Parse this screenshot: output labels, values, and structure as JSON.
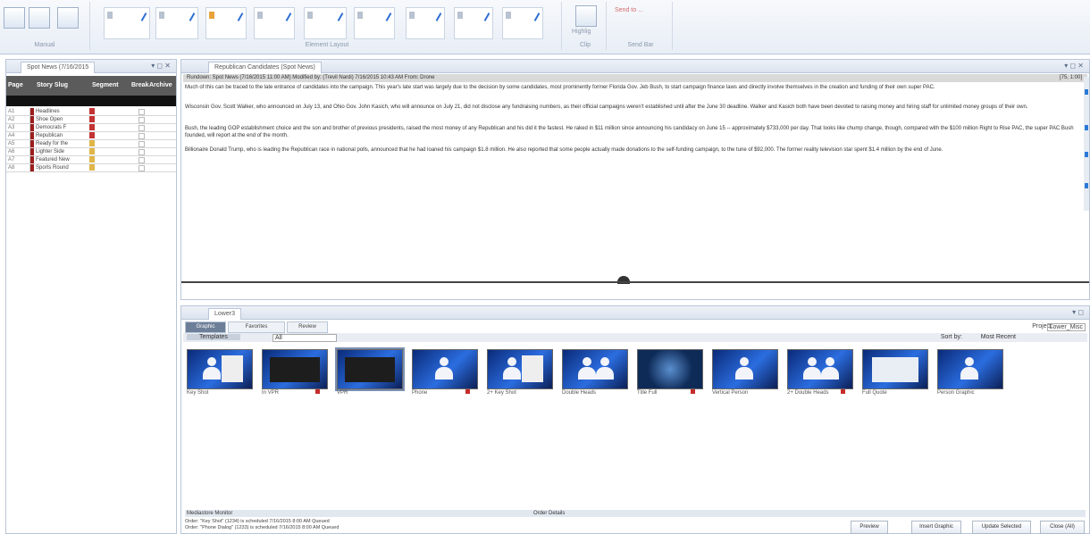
{
  "ribbon": {
    "groups": [
      {
        "label": "Manual"
      },
      {
        "label": "Element Layout"
      },
      {
        "label": "Clip"
      },
      {
        "label": "Send Bar"
      }
    ],
    "highlight_label": "Highlig",
    "send_label": "Send to ..."
  },
  "rundown_pane": {
    "tab": "Spot News (7/16/2015",
    "columns": [
      "Page",
      "Story Slug",
      "Segment",
      "Break",
      "Archive"
    ],
    "rows": [
      {
        "page": "A1",
        "slug": "Headlines"
      },
      {
        "page": "A2",
        "slug": "Shoe Open"
      },
      {
        "page": "A3",
        "slug": "Democrats F"
      },
      {
        "page": "A4",
        "slug": "Republican"
      },
      {
        "page": "A5",
        "slug": "Ready for the"
      },
      {
        "page": "A6",
        "slug": "Lighter Side"
      },
      {
        "page": "A7",
        "slug": "Featured New"
      },
      {
        "page": "A8",
        "slug": "Sports Round"
      }
    ]
  },
  "story_pane": {
    "tab": "Republican Candidates (Spot News)",
    "status": "Rundown: Spot News (7/16/2015 11:00 AM)    Modified by: (Trevil Nardi)    7/16/2015 10:43 AM    From: Drone",
    "count": "[75, 1:00]",
    "paragraphs": [
      "Much of this can be traced to the late entrance of candidates into the campaign. This year's late start was largely due to the decision by some candidates, most prominently former Florida Gov. Jeb Bush, to start campaign finance laws and directly involve themselves in the creation and funding of their own super PAC.",
      "Wisconsin Gov. Scott Walker, who announced on July 13, and Ohio Gov. John Kasich, who will announce on July 21, did not disclose any fundraising numbers, as their official campaigns weren't established until after the June 30 deadline. Walker and Kasich both have been devoted to raising money and hiring staff for unlimited money groups of their own.",
      "Bush, the leading GOP establishment choice and the son and brother of previous presidents, raised the most money of any Republican and his did it the fastest. He raked in $11 million since announcing his candidacy on June 15 -- approximately $733,000 per day. That looks like chump change, though, compared with the $100 million Right to Rise PAC, the super PAC Bush founded, will report at the end of the month.",
      "Billionaire Donald Trump, who is leading the Republican race in national polls, announced that he had loaned his campaign $1.8 million. He also reported that some people actually made donations to the self-funding campaign, to the tune of $92,000. The former reality television star spent $1.4 million by the end of June."
    ]
  },
  "graphics_pane": {
    "tab": "Lower3",
    "subtabs": [
      "Graphic",
      "Favorites",
      "Review"
    ],
    "filter_label": "Templates",
    "filter_value": "All",
    "sort_label": "Sort by:",
    "sort_value": "Most Recent",
    "group_label": "Project:",
    "group_value": "Lower_Misc",
    "thumbnails": [
      {
        "label": "Key Shot",
        "kind": "doc"
      },
      {
        "label": "In VPR",
        "kind": "photo"
      },
      {
        "label": "VPR",
        "kind": "photo"
      },
      {
        "label": "Phone",
        "kind": "person"
      },
      {
        "label": "2+ Key Shot",
        "kind": "doc2"
      },
      {
        "label": "Double Heads",
        "kind": "two"
      },
      {
        "label": "Title Full",
        "kind": "globe"
      },
      {
        "label": "Vertical Person",
        "kind": "person"
      },
      {
        "label": "2+ Double Heads",
        "kind": "two"
      },
      {
        "label": "Full Quote",
        "kind": "quote"
      },
      {
        "label": "Person Graphic",
        "kind": "person"
      }
    ],
    "mos_header_left": "Mediastore Monitor",
    "mos_header_right": "Order Details",
    "mos_rows": [
      "Order: \"Key Shot\" (1234) is scheduled        7/16/2015 8:00 AM  Queued",
      "Order: \"Phone Dialog\" (1233) is scheduled    7/16/2015 8:00 AM  Queued"
    ],
    "buttons": [
      "Preview",
      "Insert Graphic",
      "Update Selected",
      "Close (All)"
    ]
  }
}
